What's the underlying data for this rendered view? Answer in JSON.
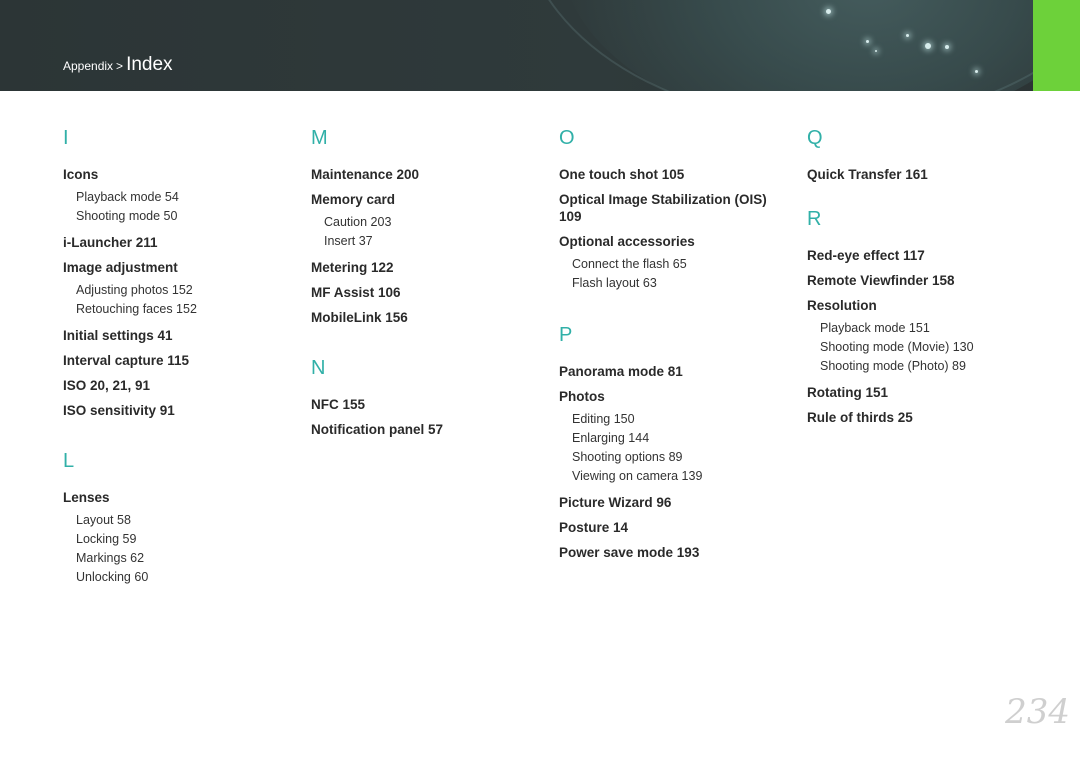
{
  "header": {
    "breadcrumb_parent": "Appendix",
    "breadcrumb_sep": ">",
    "breadcrumb_current": "Index",
    "accent_tab_color": "#6dd13a",
    "letter_color": "#31b0a8"
  },
  "columns": [
    {
      "sections": [
        {
          "letter": "I",
          "entries": [
            {
              "label": "Icons",
              "subs": [
                "Playback mode  54",
                "Shooting mode  50"
              ]
            },
            {
              "label": "i-Launcher  211",
              "subs": []
            },
            {
              "label": "Image adjustment",
              "subs": [
                "Adjusting photos  152",
                "Retouching faces  152"
              ]
            },
            {
              "label": "Initial settings  41",
              "subs": []
            },
            {
              "label": "Interval capture  115",
              "subs": []
            },
            {
              "label": "ISO  20, 21, 91",
              "subs": []
            },
            {
              "label": "ISO sensitivity  91",
              "subs": []
            }
          ]
        },
        {
          "letter": "L",
          "entries": [
            {
              "label": "Lenses",
              "subs": [
                "Layout  58",
                "Locking  59",
                "Markings  62",
                "Unlocking  60"
              ]
            }
          ]
        }
      ]
    },
    {
      "sections": [
        {
          "letter": "M",
          "entries": [
            {
              "label": "Maintenance  200",
              "subs": []
            },
            {
              "label": "Memory card",
              "subs": [
                "Caution  203",
                "Insert  37"
              ]
            },
            {
              "label": "Metering  122",
              "subs": []
            },
            {
              "label": "MF Assist  106",
              "subs": []
            },
            {
              "label": "MobileLink  156",
              "subs": []
            }
          ]
        },
        {
          "letter": "N",
          "entries": [
            {
              "label": "NFC  155",
              "subs": []
            },
            {
              "label": "Notification panel  57",
              "subs": []
            }
          ]
        }
      ]
    },
    {
      "sections": [
        {
          "letter": "O",
          "entries": [
            {
              "label": "One touch shot  105",
              "subs": []
            },
            {
              "label": "Optical Image Stabilization (OIS)  109",
              "subs": []
            },
            {
              "label": "Optional accessories",
              "subs": [
                "Connect the flash  65",
                "Flash layout  63"
              ]
            }
          ]
        },
        {
          "letter": "P",
          "entries": [
            {
              "label": "Panorama mode  81",
              "subs": []
            },
            {
              "label": "Photos",
              "subs": [
                "Editing  150",
                "Enlarging  144",
                "Shooting options  89",
                "Viewing on camera  139"
              ]
            },
            {
              "label": "Picture Wizard  96",
              "subs": []
            },
            {
              "label": "Posture  14",
              "subs": []
            },
            {
              "label": "Power save mode  193",
              "subs": []
            }
          ]
        }
      ]
    },
    {
      "sections": [
        {
          "letter": "Q",
          "entries": [
            {
              "label": "Quick Transfer  161",
              "subs": []
            }
          ]
        },
        {
          "letter": "R",
          "entries": [
            {
              "label": "Red-eye effect  117",
              "subs": []
            },
            {
              "label": "Remote Viewfinder  158",
              "subs": []
            },
            {
              "label": "Resolution",
              "subs": [
                "Playback mode  151",
                "Shooting mode (Movie)  130",
                "Shooting mode (Photo)  89"
              ]
            },
            {
              "label": "Rotating  151",
              "subs": []
            },
            {
              "label": "Rule of thirds  25",
              "subs": []
            }
          ]
        }
      ]
    }
  ],
  "page_number": "234"
}
